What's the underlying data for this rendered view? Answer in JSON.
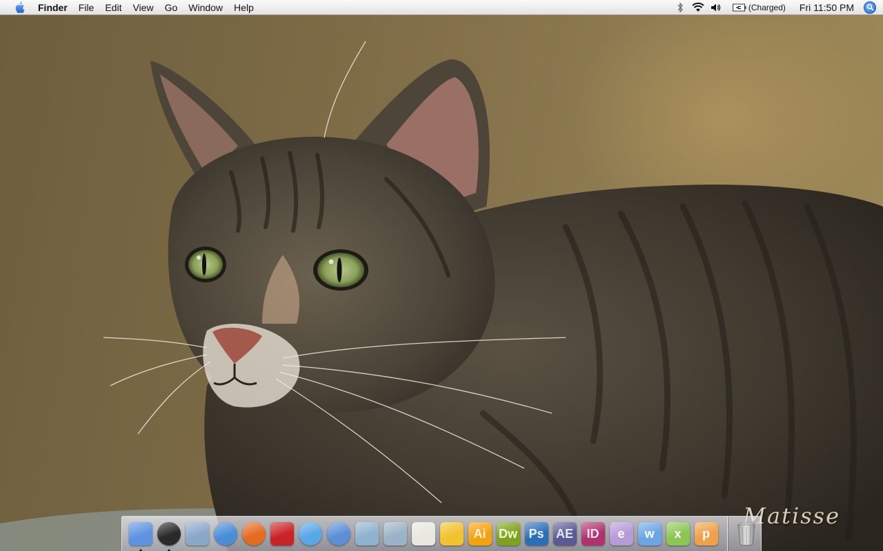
{
  "menubar": {
    "apple_icon": "apple-icon",
    "app_name": "Finder",
    "menus": [
      "File",
      "Edit",
      "View",
      "Go",
      "Window",
      "Help"
    ],
    "status_icons": [
      "bluetooth-icon",
      "wifi-icon",
      "volume-icon"
    ],
    "battery_status": "(Charged)",
    "clock": "Fri 11:50 PM",
    "spotlight_icon": "spotlight-icon"
  },
  "desktop": {
    "wallpaper": "tabby-cat-photo",
    "signature": "Matisse"
  },
  "dock": {
    "apps": [
      {
        "name": "finder",
        "icon": "finder-icon",
        "running": true,
        "bg": "#5d93e0",
        "fg": "#ffffff"
      },
      {
        "name": "dashboard",
        "icon": "dashboard-icon",
        "running": true,
        "bg": "#2a2a2a",
        "fg": "#ffffff"
      },
      {
        "name": "mail",
        "icon": "mail-icon",
        "running": false,
        "bg": "#8aa8c8",
        "fg": "#ffffff"
      },
      {
        "name": "safari",
        "icon": "safari-icon",
        "running": false,
        "bg": "#4c8ed6",
        "fg": "#ffffff"
      },
      {
        "name": "firefox",
        "icon": "firefox-icon",
        "running": false,
        "bg": "#e56b1f",
        "fg": "#ffffff"
      },
      {
        "name": "pokerstars",
        "icon": "pokerstars-icon",
        "running": false,
        "bg": "#c9232a",
        "fg": "#ffffff"
      },
      {
        "name": "ichat",
        "icon": "ichat-icon",
        "running": false,
        "bg": "#5aa7e8",
        "fg": "#ffffff"
      },
      {
        "name": "itunes",
        "icon": "itunes-icon",
        "running": false,
        "bg": "#5d8fd6",
        "fg": "#ffffff"
      },
      {
        "name": "preview",
        "icon": "preview-icon",
        "running": false,
        "bg": "#8fb2cf",
        "fg": "#ffffff"
      },
      {
        "name": "iphoto",
        "icon": "iphoto-icon",
        "running": false,
        "bg": "#9bb3c6",
        "fg": "#ffffff"
      },
      {
        "name": "textedit",
        "icon": "textedit-icon",
        "running": false,
        "bg": "#e8e8e0",
        "fg": "#555555"
      },
      {
        "name": "cyberduck",
        "icon": "cyberduck-icon",
        "running": false,
        "bg": "#f2c230",
        "fg": "#6a4a00"
      },
      {
        "name": "illustrator",
        "icon": "illustrator-icon",
        "label": "Ai",
        "running": false,
        "bg": "#f2a40f",
        "fg": "#fff3d9"
      },
      {
        "name": "dreamweaver",
        "icon": "dreamweaver-icon",
        "label": "Dw",
        "running": false,
        "bg": "#7ea21e",
        "fg": "#f0ffd0"
      },
      {
        "name": "photoshop",
        "icon": "photoshop-icon",
        "label": "Ps",
        "running": false,
        "bg": "#2d6fb6",
        "fg": "#e7f3ff"
      },
      {
        "name": "after-effects",
        "icon": "after-effects-icon",
        "label": "AE",
        "running": false,
        "bg": "#5a5b93",
        "fg": "#e6e6ff"
      },
      {
        "name": "indesign",
        "icon": "indesign-icon",
        "label": "ID",
        "running": false,
        "bg": "#b0336f",
        "fg": "#ffe4f0"
      },
      {
        "name": "entourage",
        "icon": "entourage-icon",
        "label": "e",
        "running": false,
        "bg": "#b79ad8",
        "fg": "#ffffff"
      },
      {
        "name": "word",
        "icon": "word-icon",
        "label": "w",
        "running": false,
        "bg": "#6aa6e6",
        "fg": "#ffffff"
      },
      {
        "name": "excel",
        "icon": "excel-icon",
        "label": "x",
        "running": false,
        "bg": "#8cc655",
        "fg": "#ffffff"
      },
      {
        "name": "powerpoint",
        "icon": "powerpoint-icon",
        "label": "p",
        "running": false,
        "bg": "#f0a148",
        "fg": "#ffffff"
      }
    ],
    "trash": {
      "name": "trash",
      "icon": "trash-icon"
    }
  },
  "colors": {
    "menubar_top": "#fbfbfb",
    "menubar_bottom": "#e2e2e2",
    "wallpaper_wall": "#8d7a50",
    "cat_fur": "#4a4336"
  }
}
